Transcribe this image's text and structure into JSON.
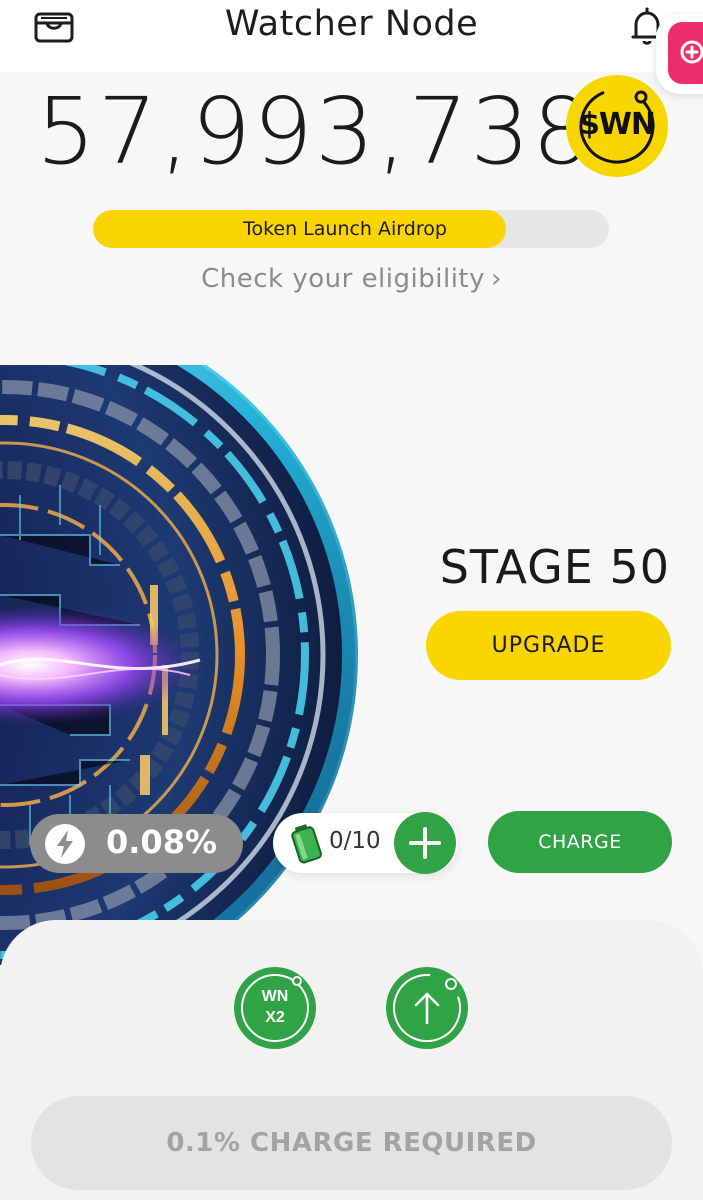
{
  "header": {
    "title": "Watcher Node",
    "left_icon": "wallet-icon",
    "right_icon": "bell-icon"
  },
  "balance": {
    "amount": "57,993,738",
    "token_symbol": "$WN"
  },
  "airdrop": {
    "label": "Token Launch Airdrop",
    "progress_percent": 80,
    "eligibility_link": "Check your eligibility"
  },
  "stage": {
    "label": "STAGE 50",
    "upgrade_label": "UPGRADE"
  },
  "charge": {
    "rate": "0.08%",
    "battery_count": "0/10",
    "charge_label": "CHARGE"
  },
  "bottom": {
    "boost_line1": "WN",
    "boost_line2": "X2",
    "required_label": "0.1% CHARGE REQUIRED"
  },
  "colors": {
    "accent_yellow": "#fad501",
    "accent_green": "#30a445",
    "floating_pink": "#ec2f6c"
  }
}
